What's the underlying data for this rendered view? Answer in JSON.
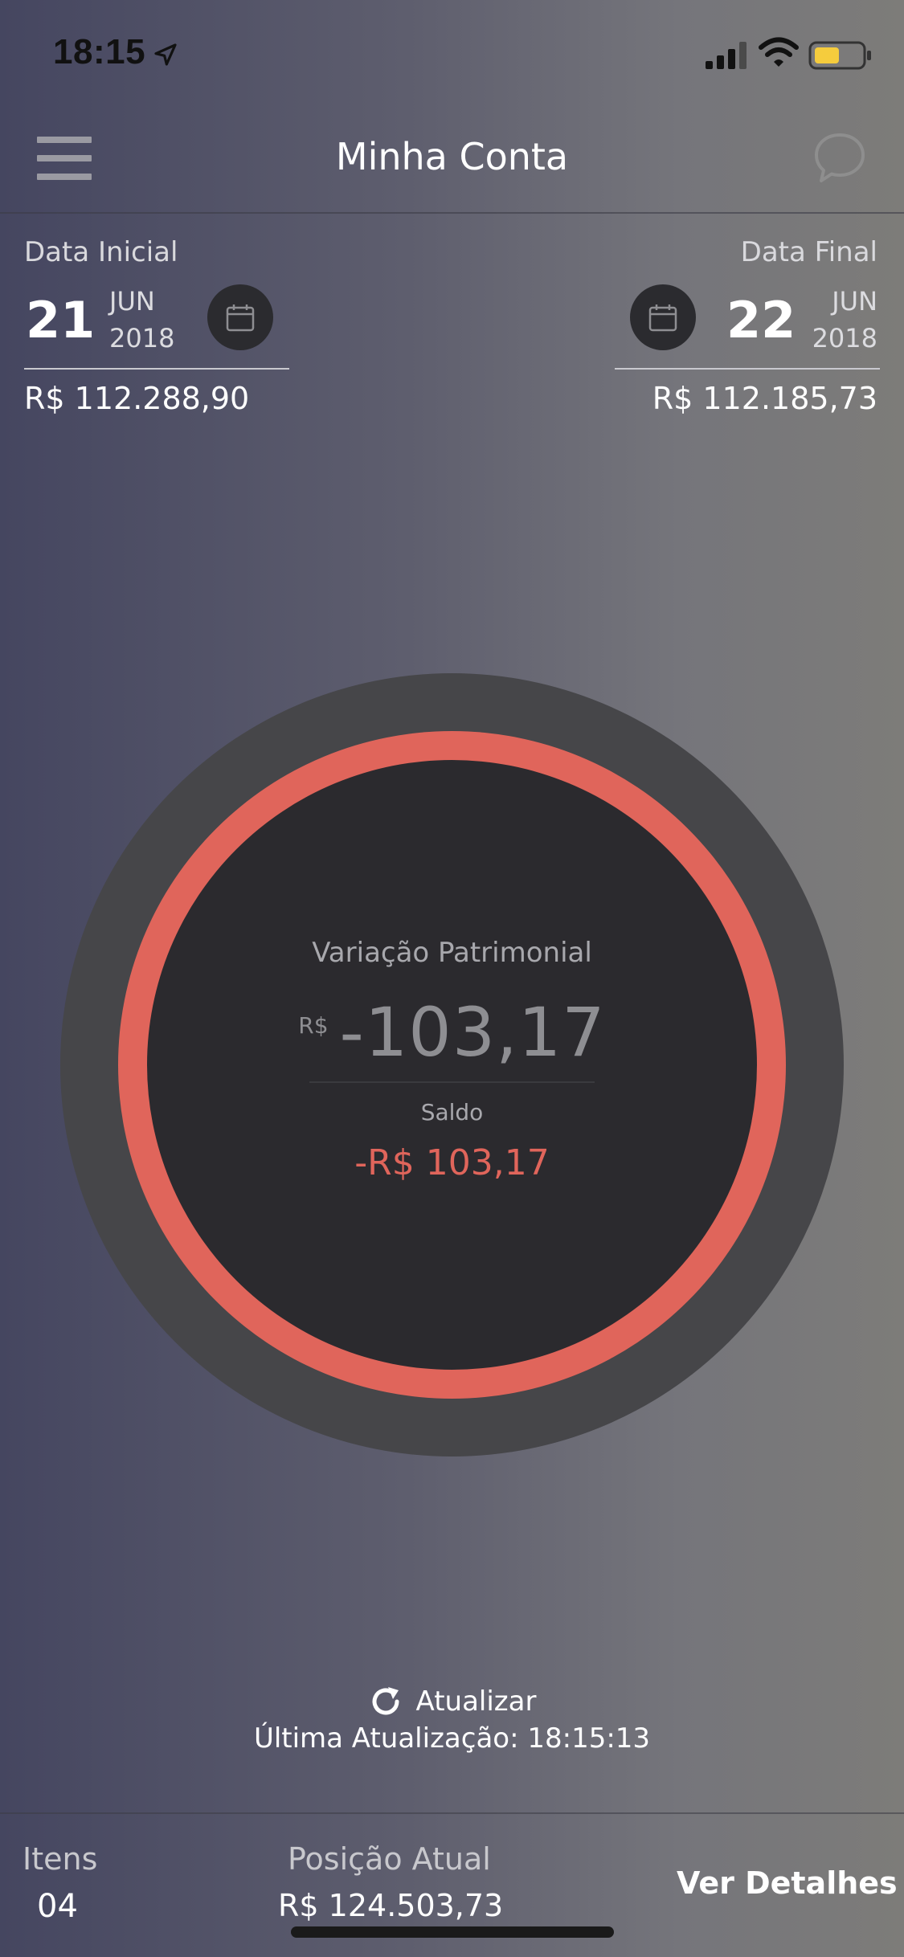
{
  "status_bar": {
    "time": "18:15",
    "battery_color": "#f5cc3d"
  },
  "header": {
    "title": "Minha Conta",
    "menu_icon": "hamburger-menu-icon",
    "chat_icon": "chat-bubble-icon"
  },
  "start_date": {
    "label": "Data Inicial",
    "day": "21",
    "month": "JUN",
    "year": "2018",
    "amount": "R$ 112.288,90"
  },
  "end_date": {
    "label": "Data Final",
    "day": "22",
    "month": "JUN",
    "year": "2018",
    "amount": "R$ 112.185,73"
  },
  "summary": {
    "label": "Variação Patrimonial",
    "currency": "R$",
    "value": "-103,17",
    "saldo_label": "Saldo",
    "saldo_value": "-R$ 103,17",
    "ring_color": "#e0655b"
  },
  "refresh": {
    "label": "Atualizar",
    "last_update": "Última Atualização: 18:15:13"
  },
  "footer": {
    "items_label": "Itens",
    "items_value": "04",
    "position_label": "Posição Atual",
    "position_value": "R$ 124.503,73",
    "details_label": "Ver Detalhes"
  }
}
